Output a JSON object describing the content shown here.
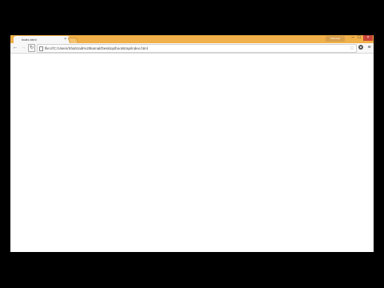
{
  "browser": {
    "tab": {
      "title": "Index.html",
      "close_glyph": "×"
    },
    "user_label": "Shahzaib",
    "window_controls": {
      "minimize": "–",
      "maximize": "□",
      "close": "×"
    },
    "toolbar": {
      "back_glyph": "←",
      "forward_glyph": "→",
      "reload_glyph": "↻",
      "address": "file:///C:/Users/Shahzaib%20kamal/Desktop/bootstrap/index.html",
      "star_glyph": "☆",
      "menu_glyph": "≡"
    },
    "colors": {
      "titlebar": "#f0b04a",
      "toolbar": "#f7f7f7",
      "content": "#ffffff",
      "background": "#000000"
    },
    "icons": [
      "page-icon",
      "star-icon",
      "extension-icon",
      "menu-icon"
    ]
  }
}
